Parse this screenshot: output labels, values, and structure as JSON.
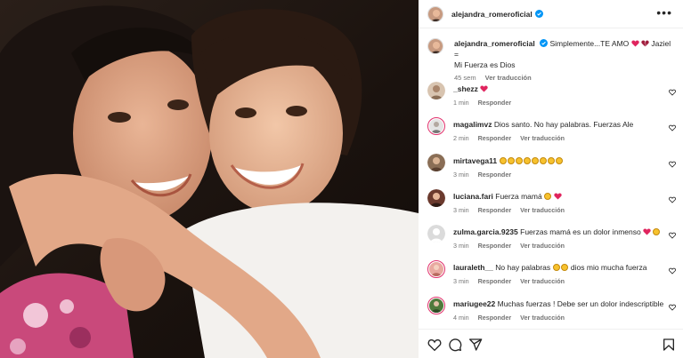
{
  "post": {
    "username": "alejandra_romeroficial",
    "more_label": "•••"
  },
  "caption": {
    "username": "alejandra_romeroficial",
    "text": "Simplemente...TE AMO",
    "text2": "Jaziel =",
    "text3": "Mi Fuerza es Dios",
    "time": "45 sem",
    "translate": "Ver traducción"
  },
  "comments": [
    {
      "user": "_shezz",
      "text": "",
      "time": "1 min",
      "reply": "Responder",
      "translate": "",
      "avatar_color": "#d8c4b0"
    },
    {
      "user": "magalimvz",
      "text": "Dios santo. No hay palabras. Fuerzas Ale",
      "time": "2 min",
      "reply": "Responder",
      "translate": "Ver traducción",
      "avatar_color": "#e4e4e4"
    },
    {
      "user": "mirtavega11",
      "text": "",
      "time": "3 min",
      "reply": "Responder",
      "translate": "",
      "avatar_color": "#8a6e56"
    },
    {
      "user": "luciana.fari",
      "text": "Fuerza mamá",
      "time": "3 min",
      "reply": "Responder",
      "translate": "Ver traducción",
      "avatar_color": "#6b3a2e"
    },
    {
      "user": "zulma.garcia.9235",
      "text": "Fuerzas mamá es un dolor inmenso",
      "time": "3 min",
      "reply": "Responder",
      "translate": "Ver traducción",
      "avatar_color": "#dbdbdb"
    },
    {
      "user": "lauraleth__",
      "text": "No hay palabras",
      "text_after": "dios mio mucha fuerza",
      "time": "3 min",
      "reply": "Responder",
      "translate": "Ver traducción",
      "avatar_color": "#e8a9a0"
    },
    {
      "user": "mariugee22",
      "text": "Muchas fuerzas ! Debe ser un dolor indescriptible",
      "time": "4 min",
      "reply": "Responder",
      "translate": "Ver traducción",
      "avatar_color": "#4f7a3c"
    }
  ],
  "colors": {
    "heart_red": "#ed4956",
    "verified_blue": "#0095f6",
    "muted": "#737373",
    "story_ring": "#e1306c"
  },
  "icons": [
    "like-icon",
    "comment-icon",
    "share-icon",
    "save-icon",
    "verified-icon",
    "more-icon"
  ]
}
